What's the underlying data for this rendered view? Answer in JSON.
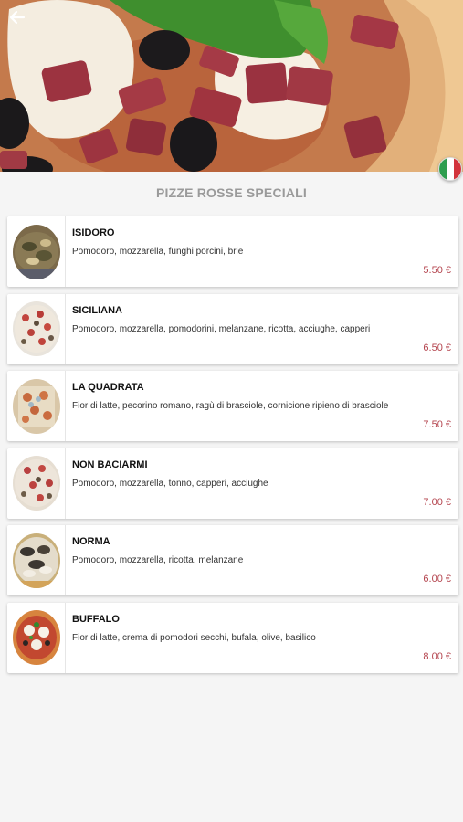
{
  "header": {
    "back_icon": "arrow-left-icon",
    "language_icon": "italian-flag-icon",
    "flag_colors": [
      "#2e9e4f",
      "#ffffff",
      "#d2343c"
    ]
  },
  "section": {
    "title": "PIZZE ROSSE SPECIALI"
  },
  "colors": {
    "price": "#b4444e",
    "title": "#9a9a9a",
    "background": "#f5f5f5"
  },
  "items": [
    {
      "name": "ISIDORO",
      "description": "Pomodoro, mozzarella, funghi porcini, brie",
      "price": "5.50 €"
    },
    {
      "name": "SICILIANA",
      "description": "Pomodoro, mozzarella, pomodorini, melanzane, ricotta, acciughe, capperi",
      "price": "6.50 €"
    },
    {
      "name": "LA QUADRATA",
      "description": "Fior di latte, pecorino romano, ragù di brasciole, cornicione ripieno di brasciole",
      "price": "7.50 €"
    },
    {
      "name": "NON BACIARMI",
      "description": "Pomodoro, mozzarella, tonno, capperi, acciughe",
      "price": "7.00 €"
    },
    {
      "name": "NORMA",
      "description": "Pomodoro, mozzarella, ricotta, melanzane",
      "price": "6.00 €"
    },
    {
      "name": "BUFFALO",
      "description": "Fior di latte, crema di pomodori secchi, bufala, olive, basilico",
      "price": "8.00 €"
    }
  ]
}
